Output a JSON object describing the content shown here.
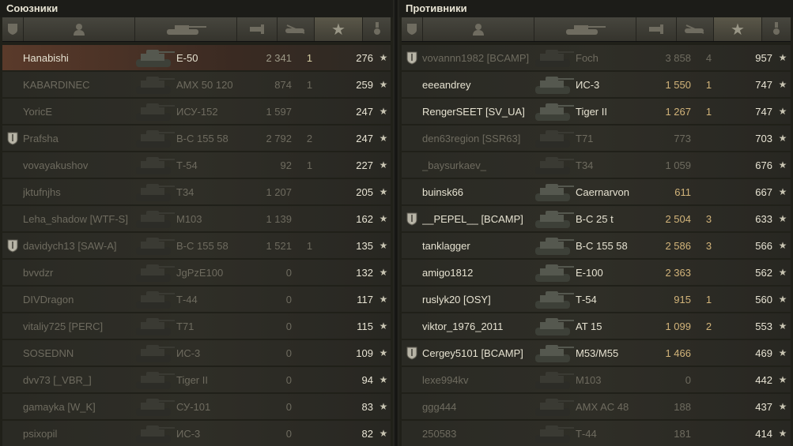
{
  "allies": {
    "title": "Союзники",
    "rows": [
      {
        "player": "Hanabishi",
        "tank": "E-50",
        "damage": "2 341",
        "kills": "1",
        "xp": "276",
        "badge": false,
        "state": "self"
      },
      {
        "player": "KABARDINEC",
        "tank": "AMX 50 120",
        "damage": "874",
        "kills": "1",
        "xp": "259",
        "badge": false,
        "state": "dead"
      },
      {
        "player": "YoricE",
        "tank": "ИСУ-152",
        "damage": "1 597",
        "kills": "",
        "xp": "247",
        "badge": false,
        "state": "dead"
      },
      {
        "player": "Prafsha",
        "tank": "В-С 155 58",
        "damage": "2 792",
        "kills": "2",
        "xp": "247",
        "badge": true,
        "state": "dead"
      },
      {
        "player": "vovayakushov",
        "tank": "Т-54",
        "damage": "92",
        "kills": "1",
        "xp": "227",
        "badge": false,
        "state": "dead"
      },
      {
        "player": "jktufnjhs",
        "tank": "Т34",
        "damage": "1 207",
        "kills": "",
        "xp": "205",
        "badge": false,
        "state": "dead"
      },
      {
        "player": "Leha_shadow [WTF-S]",
        "tank": "M103",
        "damage": "1 139",
        "kills": "",
        "xp": "162",
        "badge": false,
        "state": "dead"
      },
      {
        "player": "davidych13 [SAW-A]",
        "tank": "В-С 155 58",
        "damage": "1 521",
        "kills": "1",
        "xp": "135",
        "badge": true,
        "state": "dead"
      },
      {
        "player": "bvvdzr",
        "tank": "JgPzE100",
        "damage": "0",
        "kills": "",
        "xp": "132",
        "badge": false,
        "state": "dead"
      },
      {
        "player": "DIVDragon",
        "tank": "Т-44",
        "damage": "0",
        "kills": "",
        "xp": "117",
        "badge": false,
        "state": "dead"
      },
      {
        "player": "vitaliy725 [PERC]",
        "tank": "T71",
        "damage": "0",
        "kills": "",
        "xp": "115",
        "badge": false,
        "state": "dead"
      },
      {
        "player": "SOSEDNN",
        "tank": "ИС-3",
        "damage": "0",
        "kills": "",
        "xp": "109",
        "badge": false,
        "state": "dead"
      },
      {
        "player": "dvv73 [_VBR_]",
        "tank": "Tiger II",
        "damage": "0",
        "kills": "",
        "xp": "94",
        "badge": false,
        "state": "dead"
      },
      {
        "player": "gamayka [W_K]",
        "tank": "СУ-101",
        "damage": "0",
        "kills": "",
        "xp": "83",
        "badge": false,
        "state": "dead"
      },
      {
        "player": "psixopil",
        "tank": "ИС-3",
        "damage": "0",
        "kills": "",
        "xp": "82",
        "badge": false,
        "state": "dead"
      }
    ]
  },
  "enemies": {
    "title": "Противники",
    "rows": [
      {
        "player": "vovannn1982 [BCAMP]",
        "tank": "Foch",
        "damage": "3 858",
        "kills": "4",
        "xp": "957",
        "badge": true,
        "state": "dead"
      },
      {
        "player": "eeeandrey",
        "tank": "ИС-3",
        "damage": "1 550",
        "kills": "1",
        "xp": "747",
        "badge": false,
        "state": "alive"
      },
      {
        "player": "RengerSEET [SV_UA]",
        "tank": "Tiger II",
        "damage": "1 267",
        "kills": "1",
        "xp": "747",
        "badge": false,
        "state": "alive"
      },
      {
        "player": "den63region [SSR63]",
        "tank": "T71",
        "damage": "773",
        "kills": "",
        "xp": "703",
        "badge": false,
        "state": "dead"
      },
      {
        "player": "_baysurkaev_",
        "tank": "T34",
        "damage": "1 059",
        "kills": "",
        "xp": "676",
        "badge": false,
        "state": "dead"
      },
      {
        "player": "buinsk66",
        "tank": "Caernarvon",
        "damage": "611",
        "kills": "",
        "xp": "667",
        "badge": false,
        "state": "alive"
      },
      {
        "player": "__PEPEL__ [BCAMP]",
        "tank": "В-С 25 t",
        "damage": "2 504",
        "kills": "3",
        "xp": "633",
        "badge": true,
        "state": "alive"
      },
      {
        "player": "tanklagger",
        "tank": "В-С 155 58",
        "damage": "2 586",
        "kills": "3",
        "xp": "566",
        "badge": false,
        "state": "alive"
      },
      {
        "player": "amigo1812",
        "tank": "E-100",
        "damage": "2 363",
        "kills": "",
        "xp": "562",
        "badge": false,
        "state": "alive"
      },
      {
        "player": "ruslyk20 [OSY]",
        "tank": "Т-54",
        "damage": "915",
        "kills": "1",
        "xp": "560",
        "badge": false,
        "state": "alive"
      },
      {
        "player": "viktor_1976_2011",
        "tank": "AT 15",
        "damage": "1 099",
        "kills": "2",
        "xp": "553",
        "badge": false,
        "state": "alive"
      },
      {
        "player": "Cergey5101 [BCAMP]",
        "tank": "M53/M55",
        "damage": "1 466",
        "kills": "",
        "xp": "469",
        "badge": true,
        "state": "alive"
      },
      {
        "player": "lexe994kv",
        "tank": "M103",
        "damage": "0",
        "kills": "",
        "xp": "442",
        "badge": false,
        "state": "dead"
      },
      {
        "player": "ggg444",
        "tank": "AMX AC 48",
        "damage": "188",
        "kills": "",
        "xp": "437",
        "badge": false,
        "state": "dead"
      },
      {
        "player": "250583",
        "tank": "Т-44",
        "damage": "181",
        "kills": "",
        "xp": "414",
        "badge": false,
        "state": "dead"
      }
    ]
  },
  "icons": {
    "badge": "clan-shield-icon",
    "player": "player-icon",
    "tank": "tank-icon",
    "damage": "damage-icon",
    "kills": "kills-icon",
    "xp": "xp-star-icon",
    "medal": "medal-icon"
  },
  "colors": {
    "self_row": "#5a3a2a",
    "enemy_stat": "#d2b47a",
    "dead_text": "#6e6b5f"
  }
}
